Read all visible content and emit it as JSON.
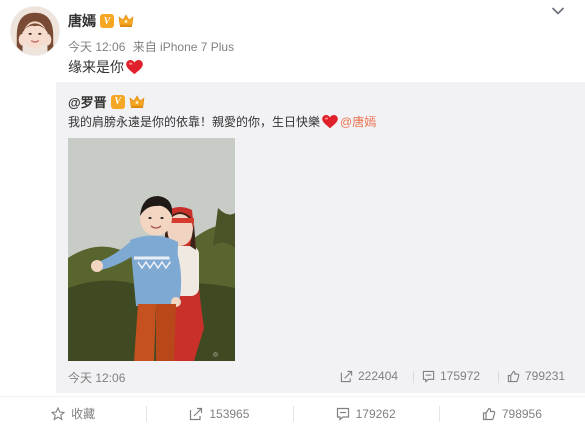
{
  "post": {
    "author": "唐嫣",
    "time": "今天 12:06",
    "source": "来自 iPhone 7 Plus",
    "text": "缘来是你"
  },
  "repost": {
    "author": "@罗晋",
    "text_before": "我的肩膀永遠是你的依靠！親愛的你，生日快樂",
    "mention": "@唐嫣",
    "time": "今天 12:06",
    "reposts": "222404",
    "comments": "175972",
    "likes": "799231"
  },
  "actions": {
    "favorite": "收藏",
    "repost_count": "153965",
    "comment_count": "179262",
    "like_count": "798956"
  },
  "colors": {
    "accent": "#eb7350",
    "heart": "#e0212b",
    "vip_badge": "#f5a623",
    "repost_bg": "#f2f2f5"
  },
  "icons": [
    "chevron-down-icon",
    "verified-v-icon",
    "crown-icon",
    "heart-emoji-icon",
    "repost-icon",
    "comment-icon",
    "like-icon",
    "star-icon"
  ]
}
